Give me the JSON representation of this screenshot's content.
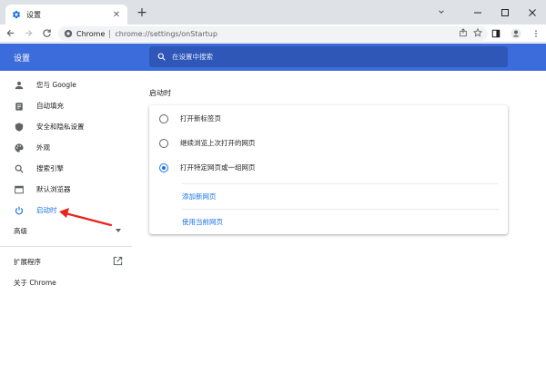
{
  "browser": {
    "tab_title": "设置",
    "omnibox_site": "Chrome",
    "omnibox_url": "chrome://settings/onStartup"
  },
  "header": {
    "title": "设置",
    "search_placeholder": "在设置中搜索"
  },
  "sidebar": {
    "items": [
      {
        "label": "您与 Google",
        "icon": "person-icon"
      },
      {
        "label": "自动填充",
        "icon": "clipboard-icon"
      },
      {
        "label": "安全和隐私设置",
        "icon": "shield-icon"
      },
      {
        "label": "外观",
        "icon": "palette-icon"
      },
      {
        "label": "搜索引擎",
        "icon": "search-icon"
      },
      {
        "label": "默认浏览器",
        "icon": "browser-icon"
      },
      {
        "label": "启动时",
        "icon": "power-icon",
        "active": true
      }
    ],
    "advanced_label": "高级",
    "extensions_label": "扩展程序",
    "about_label": "关于 Chrome"
  },
  "main": {
    "section_title": "启动时",
    "options": [
      {
        "label": "打开新标签页",
        "checked": false
      },
      {
        "label": "继续浏览上次打开的网页",
        "checked": false
      },
      {
        "label": "打开特定网页或一组网页",
        "checked": true
      }
    ],
    "add_page_link": "添加新网页",
    "use_current_link": "使用当前网页"
  },
  "colors": {
    "header_blue": "#3c6bdc",
    "accent": "#1a73e8",
    "annotation_red": "#e8251d"
  }
}
